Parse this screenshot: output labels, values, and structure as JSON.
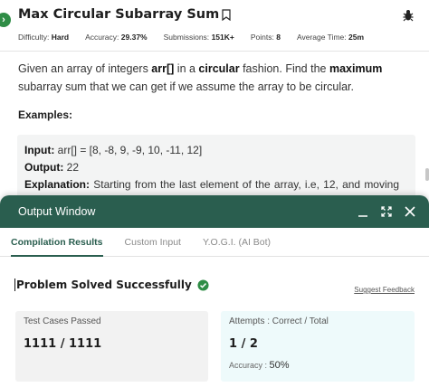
{
  "problem": {
    "side_badge_icon": "chevron-right-icon",
    "title": "Max Circular Subarray Sum",
    "meta": {
      "difficulty_label": "Difficulty:",
      "difficulty_value": "Hard",
      "accuracy_label": "Accuracy:",
      "accuracy_value": "29.37%",
      "submissions_label": "Submissions:",
      "submissions_value": "151K+",
      "points_label": "Points:",
      "points_value": "8",
      "avg_time_label": "Average Time:",
      "avg_time_value": "25m"
    },
    "description": {
      "p1": "Given an array of integers ",
      "b1": "arr[]",
      "p2": " in a ",
      "b2": "circular",
      "p3": " fashion. Find the ",
      "b3": "maximum",
      "p4": " subarray sum that we can get if we assume the array to be circular."
    },
    "examples_heading": "Examples:",
    "example": {
      "input_label": "Input:",
      "input_value": " arr[] = [8, -8, 9, -9, 10, -11, 12]",
      "output_label": "Output:",
      "output_value": " 22",
      "explanation_label": "Explanation:",
      "explanation_words": [
        "Starting",
        "from",
        "the",
        "last",
        "element",
        "of",
        "the",
        "array,",
        "i.e,",
        "12,",
        "and",
        "moving"
      ]
    }
  },
  "output_window": {
    "title": "Output Window",
    "tabs": [
      "Compilation Results",
      "Custom Input",
      "Y.O.G.I. (AI Bot)"
    ],
    "active_tab": "Compilation Results",
    "result_text": "Problem Solved Successfully",
    "feedback_link": "Suggest Feedback",
    "test_cases": {
      "label": "Test Cases Passed",
      "value": "1111 / 1111"
    },
    "attempts": {
      "label": "Attempts : Correct / Total",
      "value": "1 / 2",
      "accuracy_label": "Accuracy :",
      "accuracy_value": "50%"
    }
  },
  "colors": {
    "brand_green": "#2a5e4f",
    "success_green": "#2f8d46",
    "accent_card": "#eefafb"
  }
}
